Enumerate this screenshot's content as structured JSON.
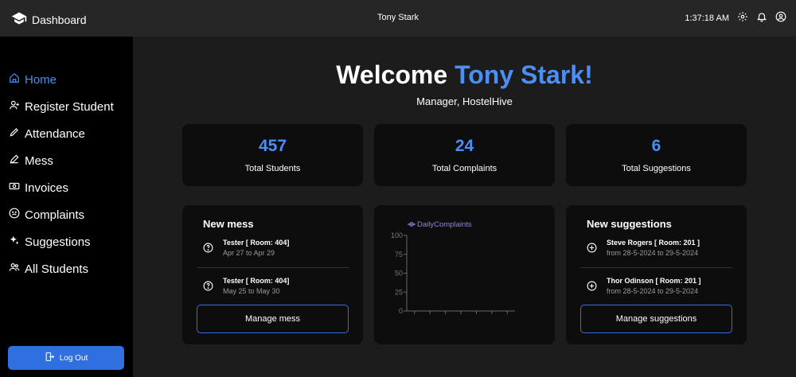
{
  "topbar": {
    "brand": "Dashboard",
    "center_title": "Tony Stark",
    "time": "1:37:18 AM"
  },
  "sidebar": {
    "items": [
      {
        "label": "Home",
        "icon": "home-icon"
      },
      {
        "label": "Register Student",
        "icon": "user-plus-icon"
      },
      {
        "label": "Attendance",
        "icon": "pencil-icon"
      },
      {
        "label": "Mess",
        "icon": "pen-icon"
      },
      {
        "label": "Invoices",
        "icon": "money-icon"
      },
      {
        "label": "Complaints",
        "icon": "frown-icon"
      },
      {
        "label": "Suggestions",
        "icon": "sparkles-icon"
      },
      {
        "label": "All Students",
        "icon": "users-icon"
      }
    ],
    "logout_label": "Log Out"
  },
  "welcome": {
    "prefix": "Welcome",
    "name": "Tony Stark!",
    "subtitle": "Manager, HostelHive"
  },
  "stats": [
    {
      "value": "457",
      "label": "Total Students"
    },
    {
      "value": "24",
      "label": "Total Complaints"
    },
    {
      "value": "6",
      "label": "Total Suggestions"
    }
  ],
  "mess": {
    "title": "New mess",
    "entries": [
      {
        "name": "Tester [ Room: 404]",
        "dates": "Apr 27 to Apr 29"
      },
      {
        "name": "Tester [ Room: 404]",
        "dates": "May 25 to May 30"
      }
    ],
    "button": "Manage mess"
  },
  "suggestions": {
    "title": "New suggestions",
    "entries": [
      {
        "name": "Steve Rogers [ Room: 201 ]",
        "dates": "from 28-5-2024 to 29-5-2024"
      },
      {
        "name": "Thor Odinson [ Room: 201 ]",
        "dates": "from 28-5-2024 to 29-5-2024"
      }
    ],
    "button": "Manage suggestions"
  },
  "colors": {
    "accent": "#4d8ef5",
    "button": "#2f6fe0",
    "chart_line": "#8a84e0"
  },
  "chart_data": {
    "type": "line",
    "series": [
      {
        "name": "DailyComplaints",
        "values": []
      }
    ],
    "categories": [
      "",
      "",
      "",
      "",
      "",
      "",
      ""
    ],
    "yticks": [
      "0",
      "25",
      "50",
      "75",
      "100"
    ],
    "ylim": [
      0,
      100
    ],
    "legend": "top"
  }
}
